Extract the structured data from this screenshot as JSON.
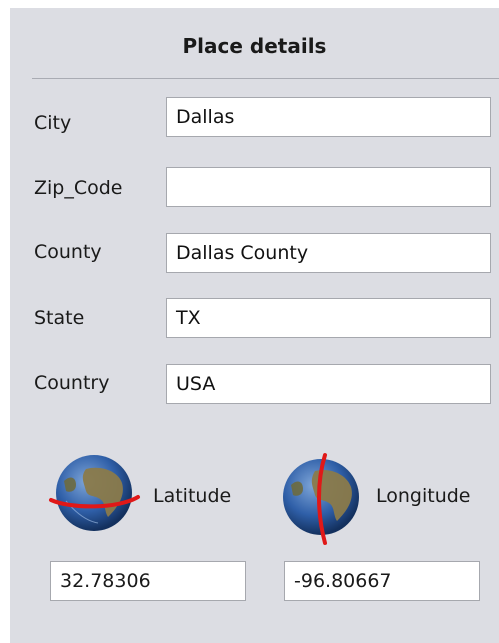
{
  "header": {
    "title": "Place details"
  },
  "fields": [
    {
      "label": "City",
      "value": "Dallas"
    },
    {
      "label": "Zip_Code",
      "value": ""
    },
    {
      "label": "County",
      "value": "Dallas County"
    },
    {
      "label": "State",
      "value": "TX"
    },
    {
      "label": "Country",
      "value": "USA"
    }
  ],
  "coordinates": {
    "latitude": {
      "label": "Latitude",
      "value": "32.78306",
      "icon": "globe-latitude-icon"
    },
    "longitude": {
      "label": "Longitude",
      "value": "-96.80667",
      "icon": "globe-longitude-icon"
    }
  },
  "colors": {
    "panel": "#dcdde3",
    "marker": "#e01818",
    "ocean": "#2f5fa8",
    "land": "#8a7a4a"
  }
}
